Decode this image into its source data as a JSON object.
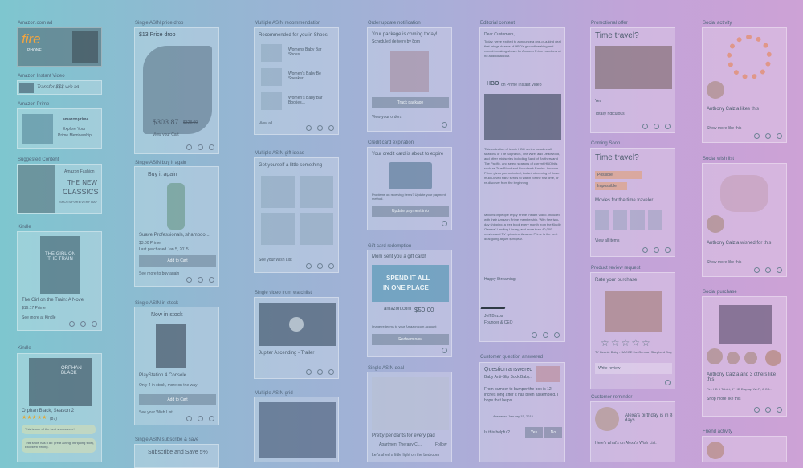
{
  "columns": {
    "c1": [
      "Amazon.com ad",
      "Amazon Instant Video",
      "Amazon Prime",
      "Suggested Content",
      "Kindle"
    ],
    "c2": [
      "Single ASIN price drop",
      "Single ASIN buy it again",
      "Single ASIN in stock",
      "Single ASIN subscribe & save"
    ],
    "c3": [
      "Multiple ASIN recommendation",
      "Multiple ASIN gift ideas",
      "Single video from watchlist",
      "Multiple ASIN grid"
    ],
    "c4": [
      "Order update notification",
      "Credit card expiration",
      "Gift card redemption",
      "Single ASIN deal"
    ],
    "c5": [
      "Editorial content",
      "Customer question answered"
    ],
    "c6": [
      "Promotional offer",
      "Coming Soon",
      "Product review request",
      "Customer reminder"
    ],
    "c7": [
      "Social activity",
      "Social wish list",
      "Social purchase",
      "Friend activity"
    ]
  },
  "cards": {
    "fire": {
      "logo": "fire",
      "sub": "PHONE"
    },
    "transfer": {
      "text": "Transfer $$$ w/o txt"
    },
    "prime_tile": {
      "logo": "amazonprime",
      "line1": "Explore Your",
      "line2": "Prime Membership"
    },
    "classics": {
      "brand": "Amazon Fashion",
      "line1": "THE NEW",
      "line2": "CLASSICS",
      "line3": "SHOES FOR EVERY DAY"
    },
    "book": {
      "title": "The Girl on the Train: A Novel",
      "cover": "THE GIRL ON THE TRAIN",
      "price": "$16.17 Prime",
      "link": "See more at Kindle"
    },
    "orphan": {
      "title": "Orphan Black, Season 2",
      "cover": "ORPHAN BLACK",
      "rating": "★★★★★",
      "count": "(87)",
      "q1": "This is one of the best shows ever!",
      "q2": "This show has it all: great acting, intriguing story, excellent writing."
    },
    "price_drop": {
      "title": "$13 Price drop",
      "price": "$303.87",
      "was": "$328.00",
      "action": "View your Cart"
    },
    "buy_again": {
      "title": "Buy it again",
      "product": "Suave Professionals, shampoo...",
      "price": "$3.00 Prime",
      "date": "Last purchased Jan 5, 2015",
      "button": "Add to Cart",
      "link": "See more to buy again"
    },
    "in_stock": {
      "title": "Now in stock",
      "product": "PlayStation 4 Console",
      "note": "Only 4 in stock, more on the way",
      "button": "Add to Cart",
      "link": "See your Wish List"
    },
    "subscribe": {
      "title": "Subscribe and Save 5%"
    },
    "shoes": {
      "title": "Recommended for you in Shoes",
      "i1": "Womens Baby Bar Shoes...",
      "i2": "Women's Baby Be Sneaker...",
      "i3": "Women's Baby Bar Booties...",
      "link": "View all"
    },
    "gift": {
      "title": "Get yourself a little something",
      "link": "See your Wish List"
    },
    "video": {
      "title": "Jupiter Ascending - Trailer"
    },
    "package": {
      "title": "Your package is coming today!",
      "sub": "Scheduled delivery by 8pm",
      "button": "Track package",
      "link": "View your orders"
    },
    "credit": {
      "title": "Your credit card is about to expire",
      "sub": "Problems on receiving items? Update your payment method.",
      "button": "Update payment info"
    },
    "giftcard": {
      "title": "Mom sent you a gift card!",
      "banner1": "SPEND IT ALL",
      "banner2": "IN ONE PLACE",
      "brand": "amazon.com",
      "amount": "$50.00",
      "note": "Image redeems to your Amazon.com account",
      "button": "Redeem now"
    },
    "pendants": {
      "title": "Pretty pendants for every pad",
      "vendor": "Apartment Therapy Cl...",
      "follow": "Follow",
      "body": "Let's shed a little light on the bedroom"
    },
    "letter": {
      "greet": "Dear Customers,",
      "p1": "Today, we're excited to announce a one-of-a-kind deal that brings dozens of HBO's groundbreaking and record-breaking shows for Amazon Prime members at no additional cost.",
      "brand1": "HBO",
      "brand2": "on Prime Instant Video",
      "p2": "This collection of iconic HBO series includes all seasons of The Sopranos, The Wire, and Deadwood, and other miniseries including Band of Brothers and The Pacific, and select seasons of current HBO hits such as True Blood and Boardwalk Empire. Amazon Prime gives you unlimited, instant streaming of these much-loved HBO series to watch for the first time, or re-discover from the beginning.",
      "p3": "Millions of people enjoy Prime Instant Video. Included with their Amazon Prime membership. With free two-day shipping, a free book every month from the Kindle Owners' Lending Library, and more than 40,000 movies and TV episodes, Amazon Prime is the best deal going at just $99/year.",
      "closing": "Happy Streaming,",
      "name": "Jeff Bezos",
      "role": "Founder & CEO"
    },
    "question": {
      "title": "Question answered",
      "sub": "Baby Anti-Slip Sock Baby...",
      "body": "From bumper to bumper the box is 12 inches long after it has been assembled. I hope that helps.",
      "author": "Answered January 15, 2015",
      "helpful": "Is this helpful?",
      "yes": "Yes",
      "no": "No"
    },
    "timetravel1": {
      "title": "Time travel?",
      "l1": "Yes",
      "l2": "Totally ridiculous"
    },
    "timetravel2": {
      "title": "Time travel?",
      "o1": "Possible",
      "o2": "Impossible",
      "section": "Movies for the time traveler",
      "link": "View all items"
    },
    "rate": {
      "title": "Rate your purchase",
      "product": "TY Beanie Baby - SARGE the German Shepherd Dog",
      "button": "Write review"
    },
    "birthday": {
      "title": "Alexa's birthday is in 8 days",
      "sub": "Here's what's on Alexa's Wish List:"
    },
    "social1": {
      "name": "Anthony Calzia likes this",
      "link": "Show more like this"
    },
    "social2": {
      "name": "Anthony Calzia wished for this",
      "link": "Show more like this"
    },
    "social3": {
      "name": "Anthony Calzia and 3 others like this",
      "sub": "Fire HD 6 Tablet, 6\" HD Display, Wi-Fi, 8 GB...",
      "link": "Shop more like this"
    }
  }
}
